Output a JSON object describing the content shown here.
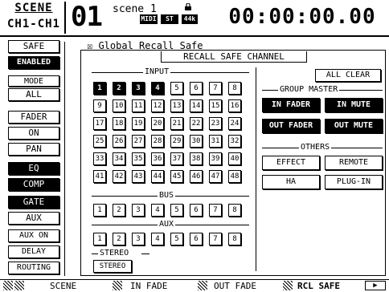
{
  "header": {
    "scene_label": "SCENE",
    "channel_label": "CH1-CH1",
    "scene_number": "01",
    "scene_name": "scene 1",
    "tags": [
      "MIDI",
      "ST",
      "44k"
    ],
    "timecode": "00:00:00.00"
  },
  "left": {
    "safe_label": "SAFE",
    "safe_state": "ENABLED",
    "mode_label": "MODE",
    "buttons": [
      "ALL",
      "FADER",
      "ON",
      "PAN",
      "EQ",
      "COMP",
      "GATE",
      "AUX",
      "AUX ON",
      "DELAY",
      "ROUTING"
    ]
  },
  "main": {
    "global_recall": "☒ Global Recall Safe",
    "title": "RECALL SAFE CHANNEL",
    "input_label": "INPUT",
    "bus_label": "BUS",
    "aux_label": "AUX",
    "stereo_label": "STEREO",
    "stereo_button": "STEREO",
    "input_cells": [
      "1",
      "2",
      "3",
      "4",
      "5",
      "6",
      "7",
      "8",
      "9",
      "10",
      "11",
      "12",
      "13",
      "14",
      "15",
      "16",
      "17",
      "18",
      "19",
      "20",
      "21",
      "22",
      "23",
      "24",
      "25",
      "26",
      "27",
      "28",
      "29",
      "30",
      "31",
      "32",
      "33",
      "34",
      "35",
      "36",
      "37",
      "38",
      "39",
      "40",
      "41",
      "42",
      "43",
      "44",
      "45",
      "46",
      "47",
      "48"
    ],
    "bus_cells": [
      "1",
      "2",
      "3",
      "4",
      "5",
      "6",
      "7",
      "8"
    ],
    "aux_cells": [
      "1",
      "2",
      "3",
      "4",
      "5",
      "6",
      "7",
      "8"
    ]
  },
  "right": {
    "all_clear": "ALL CLEAR",
    "group_master_label": "GROUP MASTER",
    "in_fader": "IN FADER",
    "in_mute": "IN MUTE",
    "out_fader": "OUT FADER",
    "out_mute": "OUT MUTE",
    "others_label": "OTHERS",
    "effect": "EFFECT",
    "remote": "REMOTE",
    "ha": "HA",
    "plugin": "PLUG-IN"
  },
  "tabs": [
    "SCENE",
    "IN FADE",
    "OUT FADE",
    "RCL SAFE"
  ]
}
